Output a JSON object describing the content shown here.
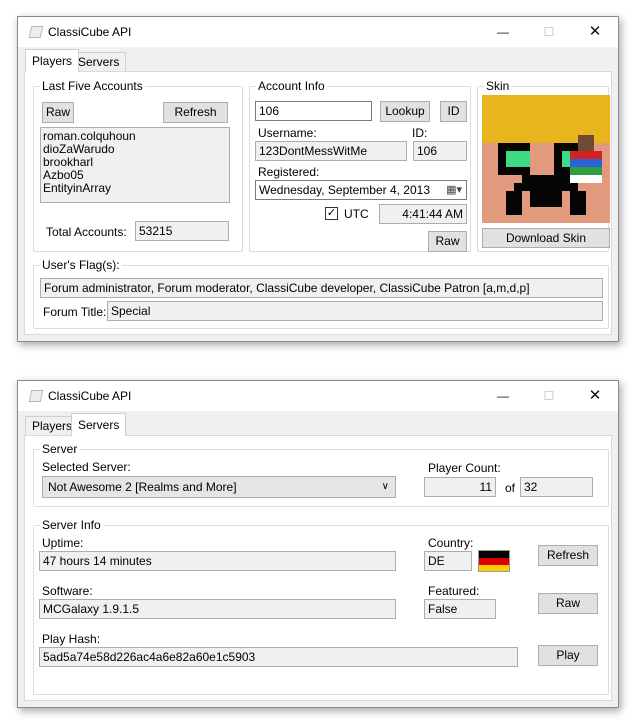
{
  "window1": {
    "title": "ClassiCube API",
    "tabs": [
      "Players",
      "Servers"
    ],
    "last_five": {
      "group_label": "Last Five Accounts",
      "raw_button": "Raw",
      "refresh_button": "Refresh",
      "accounts": [
        "roman.colquhoun",
        "dioZaWarudo",
        "brookharl",
        "Azbo05",
        "EntityinArray"
      ],
      "total_label": "Total Accounts:",
      "total_value": "53215"
    },
    "account_info": {
      "group_label": "Account Info",
      "search_value": "106",
      "lookup_button": "Lookup",
      "id_button": "ID",
      "username_label": "Username:",
      "username_value": "123DontMessWitMe",
      "id_label": "ID:",
      "id_value": "106",
      "registered_label": "Registered:",
      "registered_date": "Wednesday, September  4, 2013",
      "utc_label": "UTC",
      "utc_checked": true,
      "time_value": "4:41:44 AM",
      "raw_button": "Raw"
    },
    "skin": {
      "group_label": "Skin",
      "download_button": "Download Skin",
      "colors": {
        "hair": "#e8b51e",
        "face": "#e19a7e",
        "eyes": "#3ddc84",
        "dark": "#050505"
      }
    },
    "flags": {
      "group_label": "User's Flag(s):",
      "flags_value": "Forum administrator, Forum moderator, ClassiCube developer, ClassiCube Patron [a,m,d,p]",
      "forum_title_label": "Forum Title:",
      "forum_title_value": "Special"
    }
  },
  "window2": {
    "title": "ClassiCube API",
    "tabs": [
      "Players",
      "Servers"
    ],
    "server": {
      "group_label": "Server",
      "selected_label": "Selected Server:",
      "selected_value": "Not Awesome 2 [Realms and More]",
      "player_count_label": "Player Count:",
      "player_count": "11",
      "of_label": "of",
      "max_players": "32"
    },
    "server_info": {
      "group_label": "Server Info",
      "uptime_label": "Uptime:",
      "uptime_value": "47 hours 14 minutes",
      "country_label": "Country:",
      "country_value": "DE",
      "refresh_button": "Refresh",
      "software_label": "Software:",
      "software_value": "MCGalaxy 1.9.1.5",
      "featured_label": "Featured:",
      "featured_value": "False",
      "raw_button": "Raw",
      "play_hash_label": "Play Hash:",
      "play_hash_value": "5ad5a74e58d226ac4a6e82a60e1c5903",
      "play_button": "Play",
      "flag_colors": [
        "#000000",
        "#dd0000",
        "#ffce00"
      ]
    }
  }
}
